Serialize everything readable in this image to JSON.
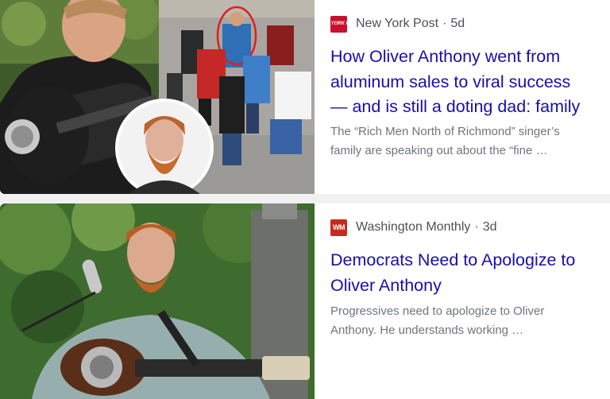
{
  "articles": [
    {
      "source": "New York Post",
      "logo_text": "NEW YORK POST",
      "age": "5d",
      "title_lines": [
        "How Oliver Anthony went from",
        "aluminum sales to viral success",
        "— and is still a doting dad: family"
      ],
      "snippet_lines": [
        "The “Rich Men North of Richmond” singer’s",
        "family are speaking out about the “fine …"
      ],
      "colors": {
        "logo_bg": "#c8102e"
      }
    },
    {
      "source": "Washington Monthly",
      "logo_text": "WM",
      "age": "3d",
      "title_lines": [
        "Democrats Need to Apologize to",
        "Oliver Anthony"
      ],
      "snippet_lines": [
        "Progressives need to apologize to Oliver",
        "Anthony. He understands working …"
      ],
      "colors": {
        "logo_bg": "#c62a1c"
      }
    }
  ],
  "colors": {
    "title": "#1a0dab",
    "source": "#4d5156",
    "snippet": "#70757a",
    "divider": "#f1f1f1"
  }
}
